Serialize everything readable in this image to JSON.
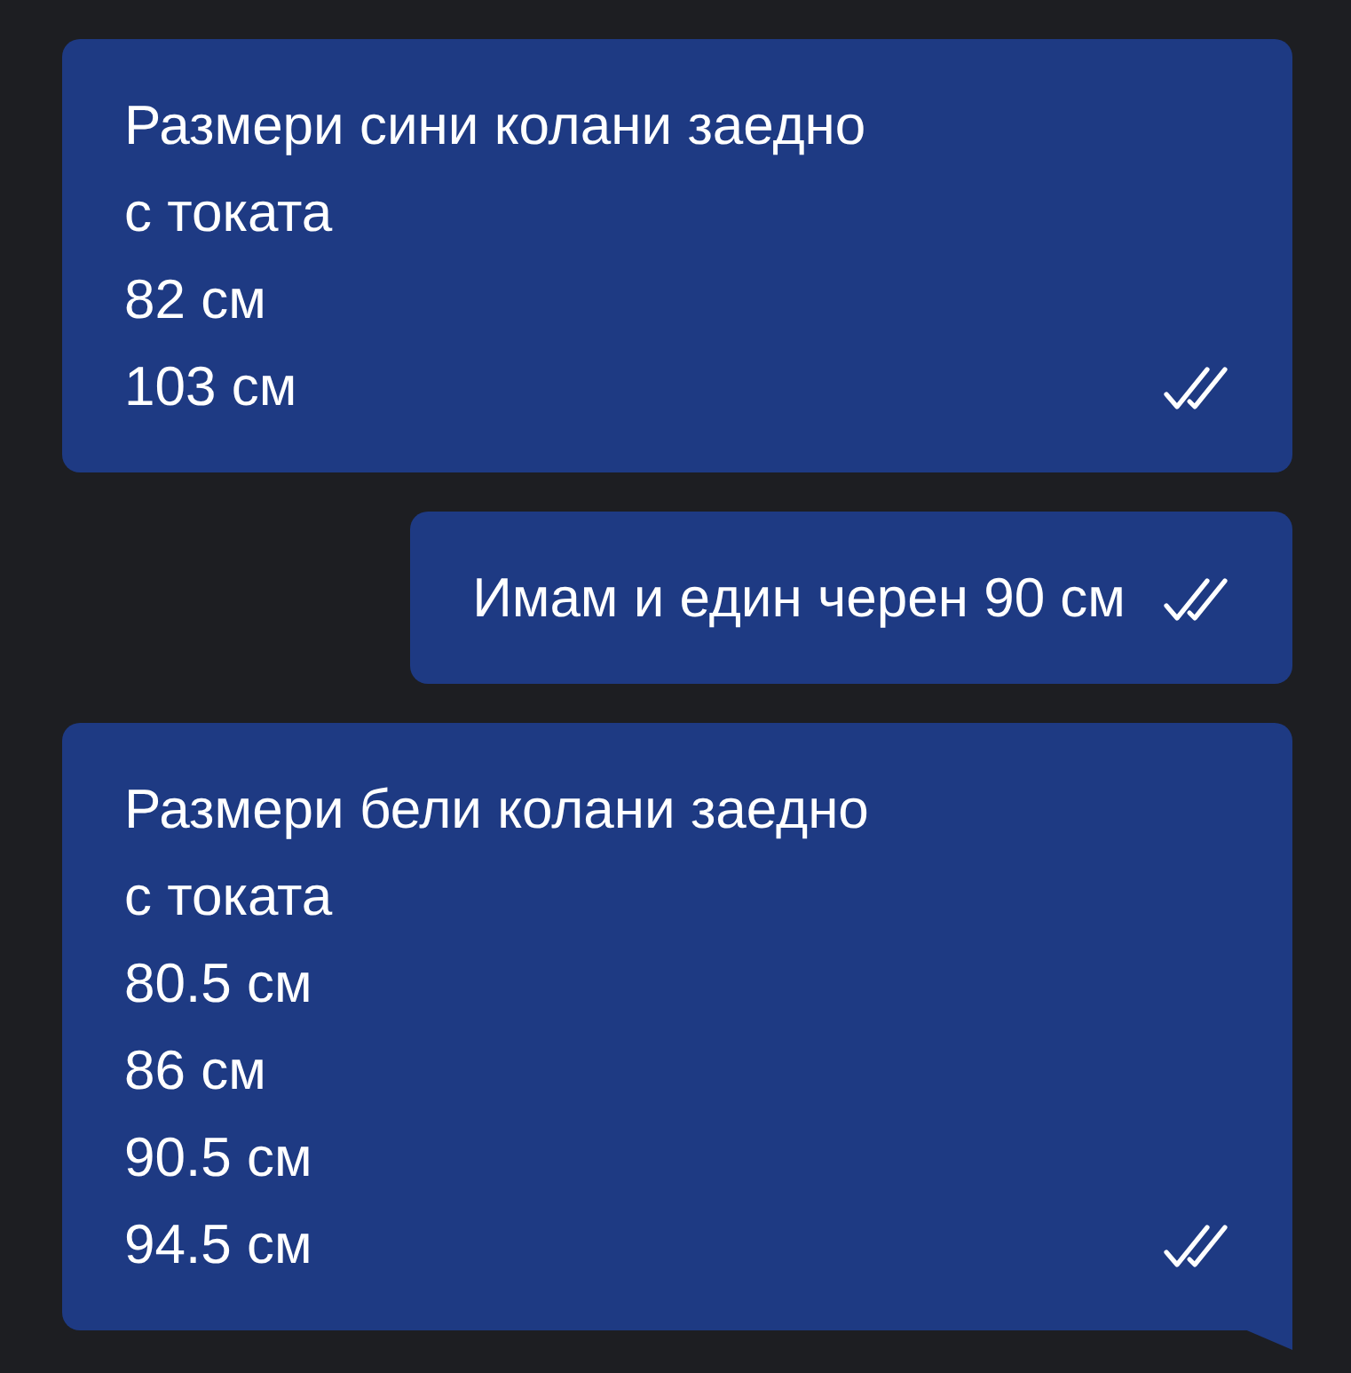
{
  "messages": [
    {
      "lines": [
        "Размери сини колани заедно",
        "с токата",
        "82 см",
        "103 см"
      ],
      "read": true,
      "tail": false,
      "kind": "block"
    },
    {
      "lines": [
        "Имам и един черен 90 см"
      ],
      "read": true,
      "tail": false,
      "kind": "inline"
    },
    {
      "lines": [
        "Размери бели колани заедно",
        "с токата",
        "80.5 см",
        "86 см",
        "90.5 см",
        "94.5 см"
      ],
      "read": true,
      "tail": true,
      "kind": "block"
    }
  ]
}
